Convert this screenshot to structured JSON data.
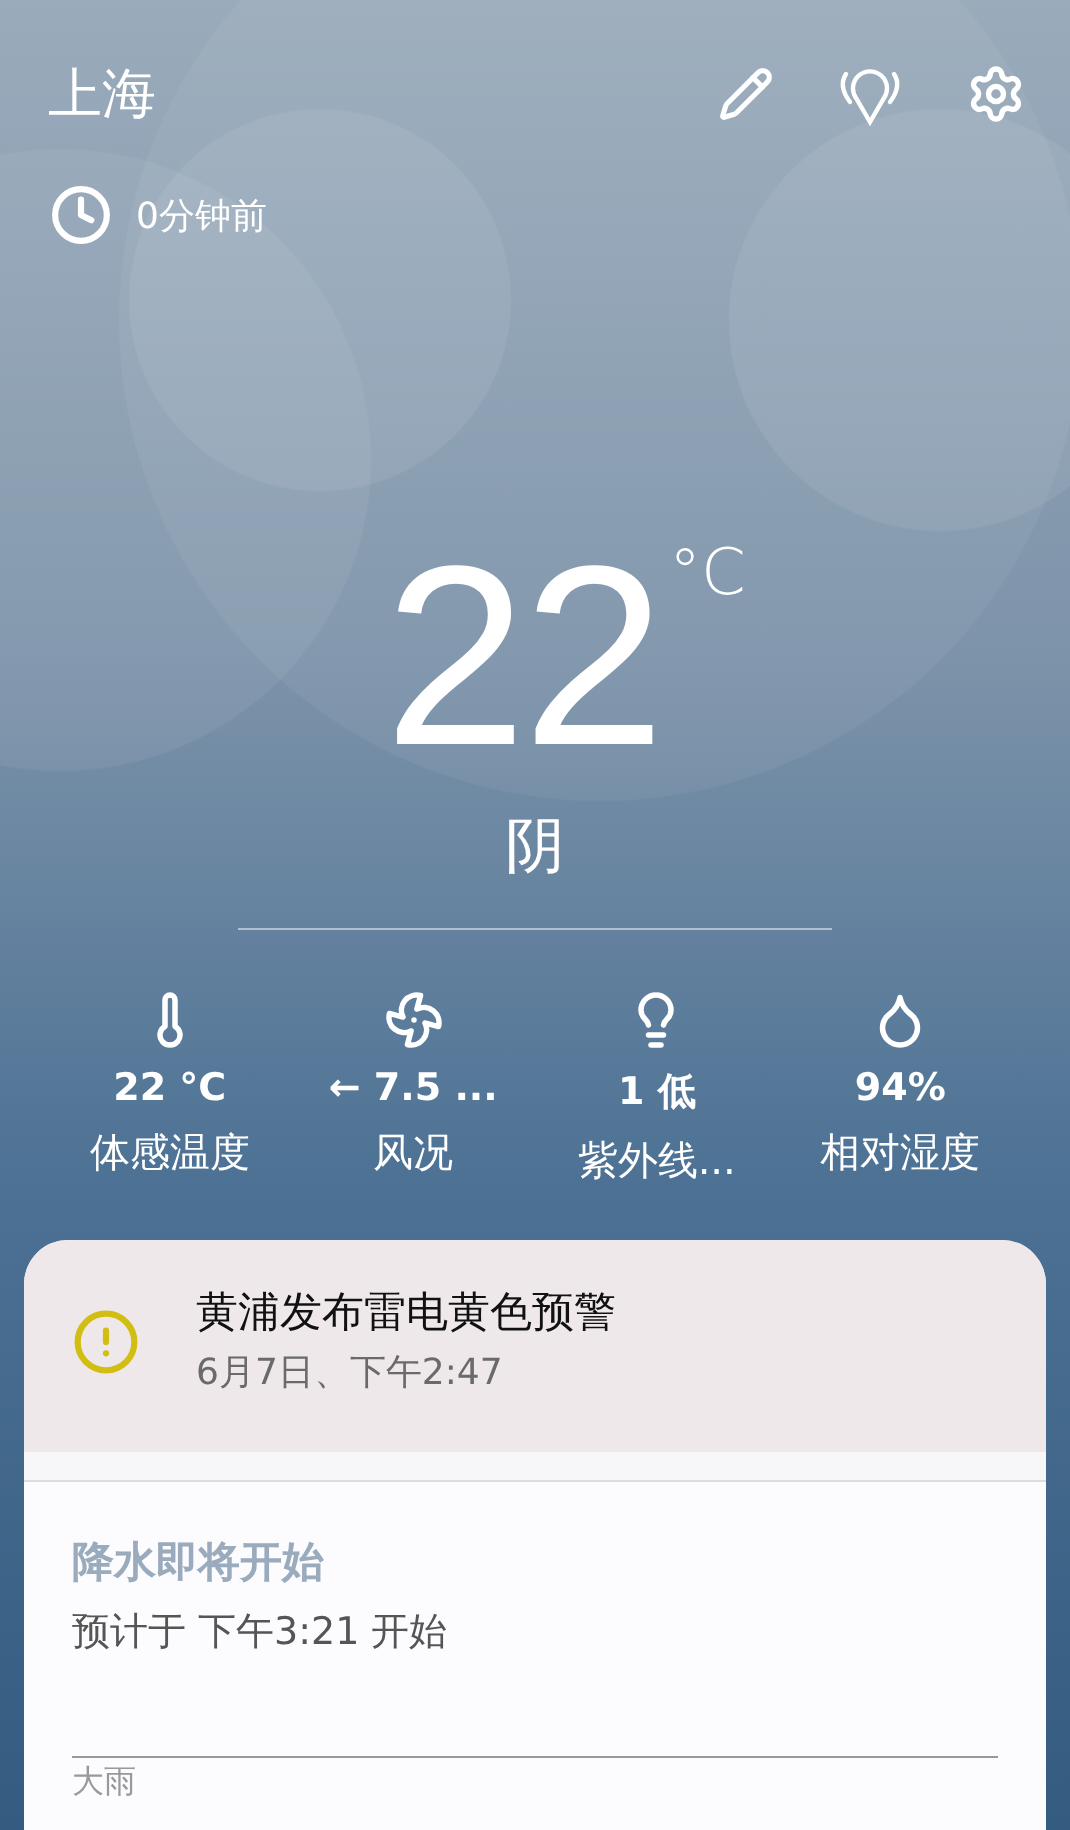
{
  "header": {
    "city": "上海",
    "updated": "0分钟前"
  },
  "current": {
    "temperature": "22",
    "unit": "°C",
    "condition": "阴"
  },
  "stats": [
    {
      "kind": "temperature",
      "value": "22 °C",
      "label": "体感温度"
    },
    {
      "kind": "wind",
      "value": "← 7.5 ...",
      "label": "风况"
    },
    {
      "kind": "uv",
      "value": "1 低",
      "label": "紫外线..."
    },
    {
      "kind": "humidity",
      "value": "94%",
      "label": "相对湿度"
    }
  ],
  "alert": {
    "title": "黄浦发布雷电黄色预警",
    "time": "6月7日、下午2:47"
  },
  "precipitation": {
    "title": "降水即将开始",
    "detail": "预计于 下午3:21 开始",
    "legend": "大雨"
  }
}
